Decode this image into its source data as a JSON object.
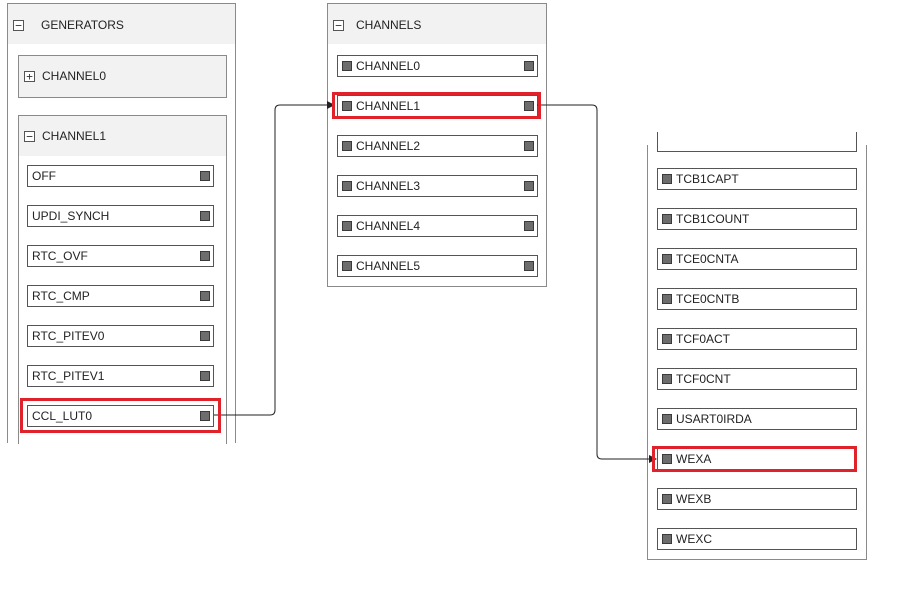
{
  "generators": {
    "title": "GENERATORS",
    "channel0": {
      "label": "CHANNEL0",
      "toggle": "+"
    },
    "channel1": {
      "label": "CHANNEL1",
      "toggle": "−",
      "items": [
        "OFF",
        "UPDI_SYNCH",
        "RTC_OVF",
        "RTC_CMP",
        "RTC_PITEV0",
        "RTC_PITEV1",
        "CCL_LUT0"
      ]
    },
    "toggle": "−"
  },
  "channels": {
    "title": "CHANNELS",
    "toggle": "−",
    "items": [
      "CHANNEL0",
      "CHANNEL1",
      "CHANNEL2",
      "CHANNEL3",
      "CHANNEL4",
      "CHANNEL5"
    ]
  },
  "users": {
    "items": [
      "TCB1CAPT",
      "TCB1COUNT",
      "TCE0CNTA",
      "TCE0CNTB",
      "TCF0ACT",
      "TCF0CNT",
      "USART0IRDA",
      "WEXA",
      "WEXB",
      "WEXC"
    ]
  },
  "connections": [
    {
      "from": "CCL_LUT0",
      "to": "CHANNEL1"
    },
    {
      "from": "CHANNEL1",
      "to": "WEXA"
    }
  ],
  "colors": {
    "highlight": "#e0222b",
    "port": "#6d6d6d",
    "header_bg": "#f2f2f2"
  }
}
